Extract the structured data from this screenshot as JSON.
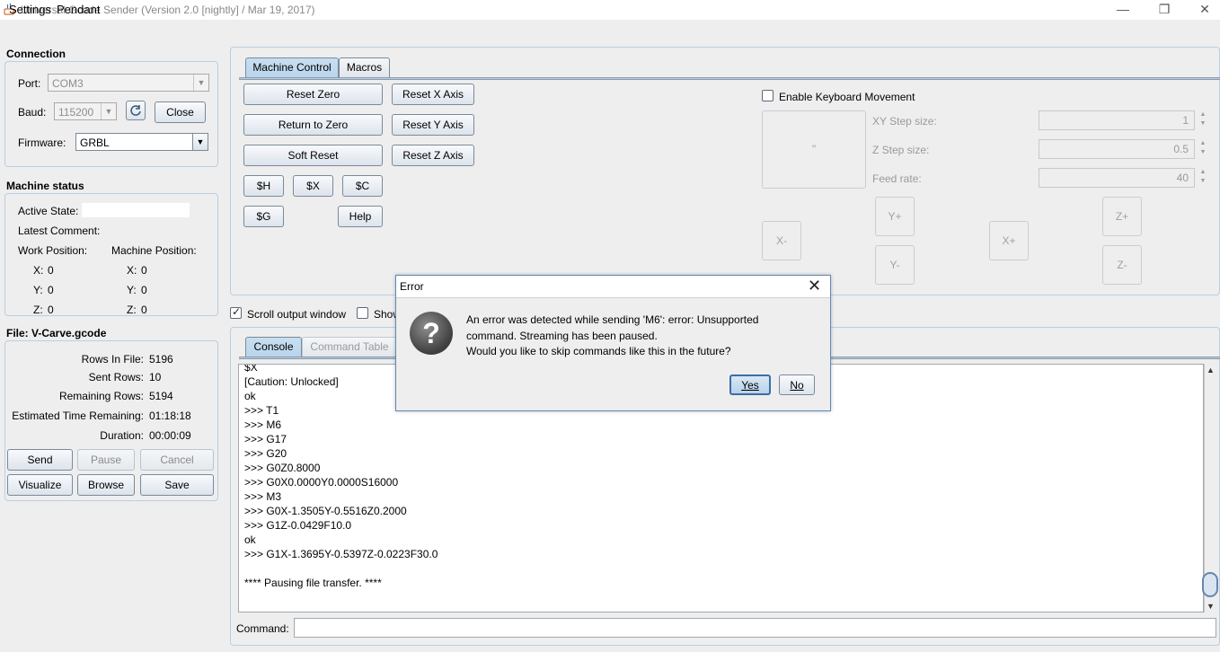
{
  "window": {
    "title": "Universal Gcode Sender (Version 2.0 [nightly]  / Mar 19, 2017)",
    "minimize": "—",
    "maximize": "❐",
    "close": "✕"
  },
  "menu": {
    "items": [
      "Settings",
      "Pendant"
    ]
  },
  "connection": {
    "title": "Connection",
    "port_label": "Port:",
    "port_value": "COM3",
    "baud_label": "Baud:",
    "baud_value": "115200",
    "refresh_icon": "refresh-icon",
    "close_button": "Close",
    "firmware_label": "Firmware:",
    "firmware_value": "GRBL"
  },
  "machine_status": {
    "title": "Machine status",
    "active_state_label": "Active State:",
    "active_state_value": "",
    "latest_comment_label": "Latest Comment:",
    "work_position_label": "Work Position:",
    "machine_position_label": "Machine Position:",
    "work": {
      "x_label": "X:",
      "x": "0",
      "y_label": "Y:",
      "y": "0",
      "z_label": "Z:",
      "z": "0"
    },
    "machine": {
      "x_label": "X:",
      "x": "0",
      "y_label": "Y:",
      "y": "0",
      "z_label": "Z:",
      "z": "0"
    }
  },
  "file": {
    "title": "File: V-Carve.gcode",
    "rows_in_file_label": "Rows In File:",
    "rows_in_file": "5196",
    "sent_rows_label": "Sent Rows:",
    "sent_rows": "10",
    "remaining_rows_label": "Remaining Rows:",
    "remaining_rows": "5194",
    "est_time_label": "Estimated Time Remaining:",
    "est_time": "01:18:18",
    "duration_label": "Duration:",
    "duration": "00:00:09",
    "buttons": {
      "send": "Send",
      "pause": "Pause",
      "cancel": "Cancel",
      "visualize": "Visualize",
      "browse": "Browse",
      "save": "Save"
    }
  },
  "top_tabs": [
    "Machine Control",
    "Macros"
  ],
  "machine_control": {
    "reset_zero": "Reset Zero",
    "return_to_zero": "Return to Zero",
    "soft_reset": "Soft Reset",
    "reset_x": "Reset X Axis",
    "reset_y": "Reset Y Axis",
    "reset_z": "Reset Z Axis",
    "cmd_h": "$H",
    "cmd_x": "$X",
    "cmd_c": "$C",
    "cmd_g": "$G",
    "help": "Help",
    "enable_keyboard": "Enable Keyboard Movement",
    "enable_keyboard_checked": false,
    "xy_step_label": "XY Step size:",
    "xy_step": "1",
    "z_step_label": "Z Step size:",
    "z_step": "0.5",
    "feed_label": "Feed rate:",
    "feed": "40",
    "jog_center": "\"",
    "jog": {
      "x_minus": "X-",
      "x_plus": "X+",
      "y_plus": "Y+",
      "y_minus": "Y-",
      "z_plus": "Z+",
      "z_minus": "Z-"
    }
  },
  "options": {
    "scroll_output": "Scroll output window",
    "scroll_output_checked": true,
    "show_partial": "Show"
  },
  "console_tabs": [
    "Console",
    "Command Table"
  ],
  "console": {
    "lines": [
      "$X",
      "[Caution: Unlocked]",
      "ok",
      ">>> T1",
      ">>> M6",
      ">>> G17",
      ">>> G20",
      ">>> G0Z0.8000",
      ">>> G0X0.0000Y0.0000S16000",
      ">>> M3",
      ">>> G0X-1.3505Y-0.5516Z0.2000",
      ">>> G1Z-0.0429F10.0",
      "ok",
      ">>> G1X-1.3695Y-0.5397Z-0.0223F30.0",
      "",
      "**** Pausing file transfer. ****"
    ]
  },
  "command": {
    "label": "Command:",
    "value": ""
  },
  "dialog": {
    "title": "Error",
    "close": "✕",
    "icon": "question-icon",
    "icon_glyph": "?",
    "message_line1": "An error was detected while sending 'M6': error: Unsupported",
    "message_line2": "command. Streaming has been paused.",
    "message_line3": "Would you like to skip commands like this in the future?",
    "yes": "Yes",
    "no": "No"
  }
}
